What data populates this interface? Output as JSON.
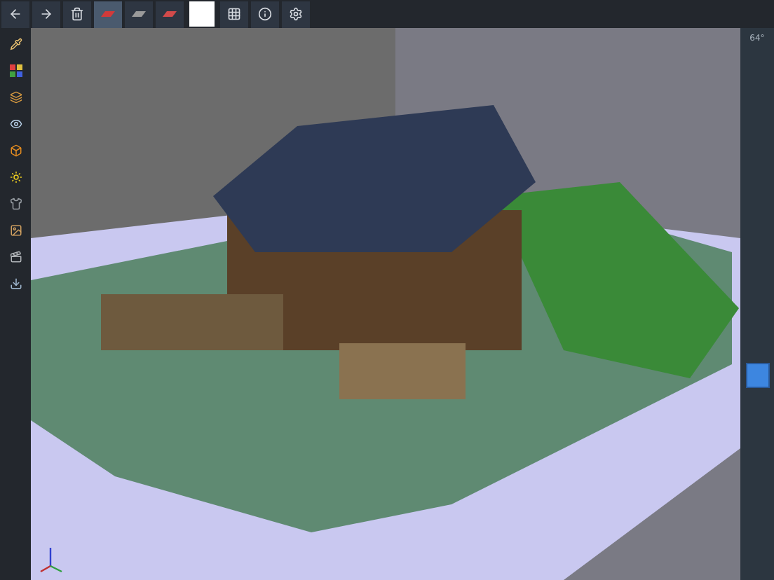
{
  "toolbar": [
    {
      "kind": "back"
    },
    {
      "kind": "forward"
    },
    {
      "kind": "delete"
    },
    {
      "kind": "mode",
      "selected": true,
      "color": "#d23a3a"
    },
    {
      "kind": "mode",
      "selected": false,
      "color": "#9a9a9a"
    },
    {
      "kind": "mode",
      "selected": false,
      "color": "#d24a4a"
    },
    {
      "kind": "swatch",
      "color": "#ffffff"
    },
    {
      "kind": "grid"
    },
    {
      "kind": "info"
    },
    {
      "kind": "settings"
    }
  ],
  "sidebar": {
    "tools": [
      {
        "kind": "pipette"
      },
      {
        "kind": "palette"
      },
      {
        "kind": "layer"
      },
      {
        "kind": "eye"
      },
      {
        "kind": "cube"
      },
      {
        "kind": "light"
      },
      {
        "kind": "shirt"
      },
      {
        "kind": "image"
      },
      {
        "kind": "clapper"
      },
      {
        "kind": "export"
      }
    ]
  },
  "right_panel": {
    "angle": "64°",
    "zoom_slider": {
      "level": 0.37
    }
  }
}
